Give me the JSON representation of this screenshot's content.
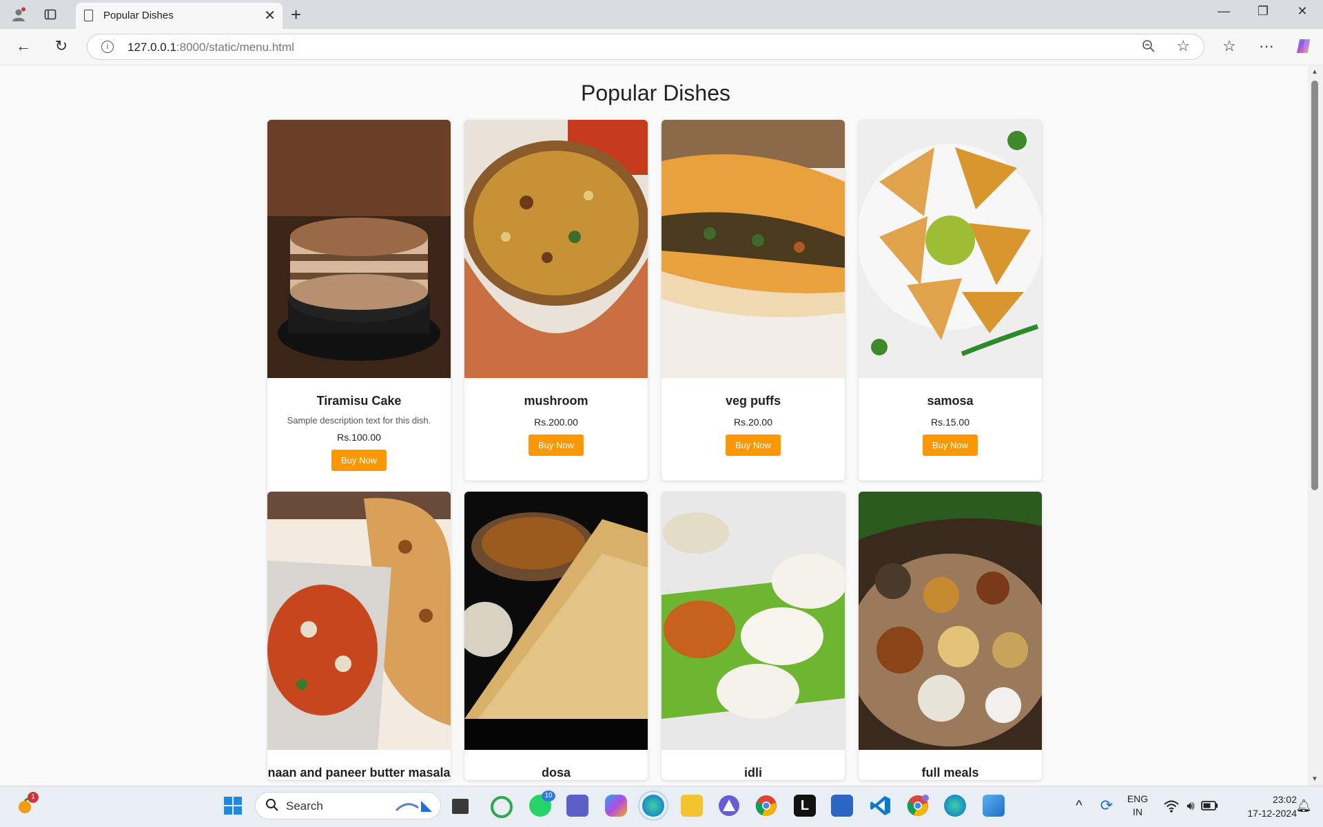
{
  "browser": {
    "tab_title": "Popular Dishes",
    "url_host": "127.0.0.1",
    "url_path": ":8000/static/menu.html",
    "new_tab": "+",
    "close_tab": "✕"
  },
  "page": {
    "heading": "Popular Dishes",
    "buy_label": "Buy Now",
    "dishes": [
      {
        "name": "Tiramisu Cake",
        "description": "Sample description text for this dish.",
        "price": "Rs.100.00"
      },
      {
        "name": "mushroom",
        "price": "Rs.200.00"
      },
      {
        "name": "veg puffs",
        "price": "Rs.20.00"
      },
      {
        "name": "samosa",
        "price": "Rs.15.00"
      },
      {
        "name": "naan and paneer butter masala"
      },
      {
        "name": "dosa"
      },
      {
        "name": "idli"
      },
      {
        "name": "full meals"
      }
    ]
  },
  "taskbar": {
    "search_label": "Search",
    "lang_line1": "ENG",
    "lang_line2": "IN",
    "time": "23:02",
    "date": "17-12-2024",
    "whatsapp_badge": "10",
    "widget_badge": "1"
  },
  "colors": {
    "buy_button": "#ff9800",
    "page_background": "#f9f9f9"
  }
}
